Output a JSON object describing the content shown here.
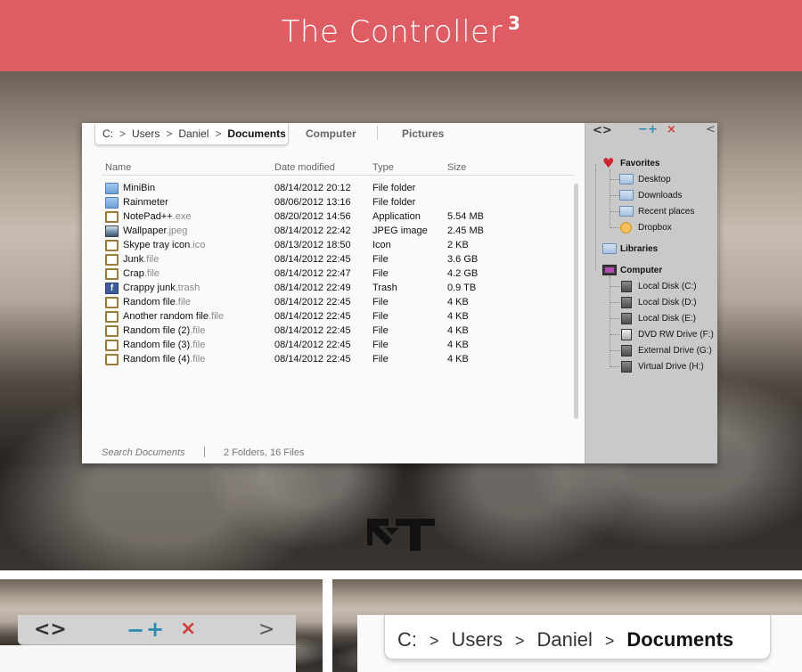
{
  "banner": {
    "title": "The Controller",
    "superscript": "3"
  },
  "explorer": {
    "breadcrumb": {
      "drive": "C:",
      "sep": ">",
      "p1": "Users",
      "p2": "Daniel",
      "current": "Documents"
    },
    "tabs": [
      "Computer",
      "Pictures"
    ],
    "columns": {
      "name": "Name",
      "date": "Date modified",
      "type": "Type",
      "size": "Size"
    },
    "files": [
      {
        "name": "MiniBin",
        "ext": "",
        "date": "08/14/2012 20:12",
        "type": "File folder",
        "size": "",
        "icon": "folder-icon"
      },
      {
        "name": "Rainmeter",
        "ext": "",
        "date": "08/06/2012 13:16",
        "type": "File folder",
        "size": "",
        "icon": "folder-icon"
      },
      {
        "name": "NotePad++",
        "ext": ".exe",
        "date": "08/20/2012 14:56",
        "type": "Application",
        "size": "5.54 MB",
        "icon": "file-icon"
      },
      {
        "name": "Wallpaper",
        "ext": ".jpeg",
        "date": "08/14/2012 22:42",
        "type": "JPEG image",
        "size": "2.45 MB",
        "icon": "image-icon"
      },
      {
        "name": "Skype tray icon",
        "ext": ".ico",
        "date": "08/13/2012 18:50",
        "type": "Icon",
        "size": "2 KB",
        "icon": "file-icon"
      },
      {
        "name": "Junk",
        "ext": ".file",
        "date": "08/14/2012 22:45",
        "type": "File",
        "size": "3.6 GB",
        "icon": "file-icon"
      },
      {
        "name": "Crap",
        "ext": ".file",
        "date": "08/14/2012 22:47",
        "type": "File",
        "size": "4.2 GB",
        "icon": "file-icon"
      },
      {
        "name": "Crappy junk",
        "ext": ".trash",
        "date": "08/14/2012 22:49",
        "type": "Trash",
        "size": "0.9 TB",
        "icon": "facebook-icon"
      },
      {
        "name": "Random file",
        "ext": ".file",
        "date": "08/14/2012 22:45",
        "type": "File",
        "size": "4 KB",
        "icon": "file-icon"
      },
      {
        "name": "Another random file",
        "ext": ".file",
        "date": "08/14/2012 22:45",
        "type": "File",
        "size": "4 KB",
        "icon": "file-icon"
      },
      {
        "name": "Random file (2)",
        "ext": ".file",
        "date": "08/14/2012 22:45",
        "type": "File",
        "size": "4 KB",
        "icon": "file-icon"
      },
      {
        "name": "Random file (3)",
        "ext": ".file",
        "date": "08/14/2012 22:45",
        "type": "File",
        "size": "4 KB",
        "icon": "file-icon"
      },
      {
        "name": "Random file (4)",
        "ext": ".file",
        "date": "08/14/2012 22:45",
        "type": "File",
        "size": "4 KB",
        "icon": "file-icon"
      }
    ],
    "status": {
      "search_placeholder": "Search Documents",
      "count": "2 Folders, 16 Files"
    }
  },
  "sidebar": {
    "controls": {
      "back_forward": "<>",
      "minimize": "−",
      "maximize": "+",
      "close": "×",
      "collapse": "<"
    },
    "favorites": {
      "label": "Favorites",
      "items": [
        "Desktop",
        "Downloads",
        "Recent places",
        "Dropbox"
      ]
    },
    "libraries": {
      "label": "Libraries"
    },
    "computer": {
      "label": "Computer",
      "items": [
        "Local Disk (C:)",
        "Local Disk (D:)",
        "Local Disk (E:)",
        "DVD RW Drive (F:)",
        "External Drive (G:)",
        "Virtual Drive (H:)"
      ]
    }
  },
  "logo": {
    "text": "RT"
  },
  "zoom": {
    "controls": {
      "back_forward": "<>",
      "minimize": "−",
      "maximize": "+",
      "close": "×",
      "expand": ">"
    },
    "breadcrumb": {
      "drive": "C:",
      "sep": ">",
      "p1": "Users",
      "p2": "Daniel",
      "current": "Documents"
    }
  },
  "colors": {
    "banner": "#e05c63",
    "accent_blue": "#2b8ab0",
    "close_red": "#d23a3a"
  }
}
